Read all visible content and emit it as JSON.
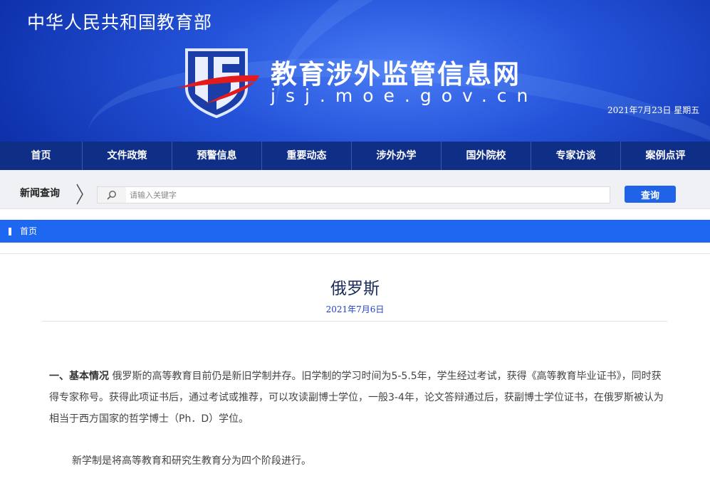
{
  "header": {
    "ministry": "中华人民共和国教育部",
    "site_title": "教育涉外监管信息网",
    "site_domain": "jsj.moe.gov.cn",
    "date": "2021年7月23日 星期五"
  },
  "nav": {
    "items": [
      "首页",
      "文件政策",
      "预警信息",
      "重要动态",
      "涉外办学",
      "国外院校",
      "专家访谈",
      "案例点评"
    ]
  },
  "search": {
    "label": "新闻查询",
    "placeholder": "请输入关键字",
    "value": "",
    "button_label": "查询",
    "icon": "search-icon"
  },
  "breadcrumb": {
    "home": "首页"
  },
  "article": {
    "title": "俄罗斯",
    "date": "2021年7月6日",
    "para1_lead": "一、基本情况",
    "para1_text": " 俄罗斯的高等教育目前仍是新旧学制并存。旧学制的学习时间为5-5.5年，学生经过考试，获得《高等教育毕业证书》，同时获得专家称号。获得此项证书后，通过考试或推荐，可以攻读副博士学位，一般3-4年，论文答辩通过后，获副博士学位证书，在俄罗斯被认为相当于西方国家的哲学博士（Ph．D）学位。",
    "para2": "新学制是将高等教育和研究生教育分为四个阶段进行。"
  },
  "colors": {
    "nav_bg": "#0f2e86",
    "breadcrumb_bg": "#1e67f1",
    "search_button_bg": "#1f63e8",
    "title_color": "#1a2b5c",
    "date_color": "#2140c8"
  }
}
